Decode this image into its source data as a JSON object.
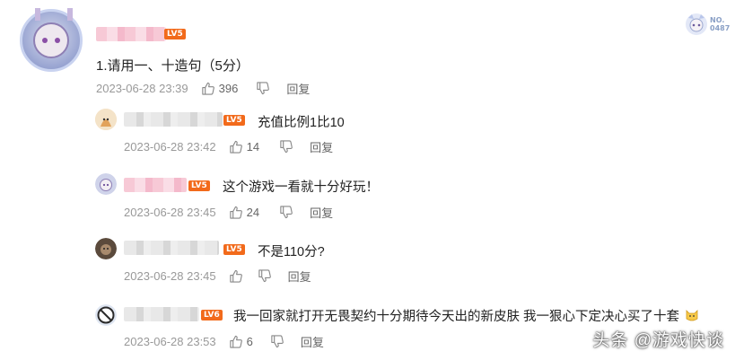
{
  "main_comment": {
    "level_badge": "LV5",
    "text": "1.请用一、十造句（5分）",
    "time": "2023-06-28 23:39",
    "likes": "396",
    "reply_label": "回复"
  },
  "top_right_badge": {
    "label_line1": "NO.",
    "label_line2": "0487"
  },
  "replies": [
    {
      "level_badge": "LV5",
      "text": "充值比例1比10",
      "time": "2023-06-28 23:42",
      "likes": "14",
      "reply_label": "回复"
    },
    {
      "level_badge": "LV5",
      "text": "这个游戏一看就十分好玩！",
      "time": "2023-06-28 23:45",
      "likes": "24",
      "reply_label": "回复"
    },
    {
      "level_badge": "LV5",
      "text": "不是110分?",
      "time": "2023-06-28 23:45",
      "likes": "",
      "reply_label": "回复"
    },
    {
      "level_badge": "LV6",
      "text": "我一回家就打开无畏契约十分期待今天出的新皮肤 我一狠心下定决心买了十套",
      "time": "2023-06-28 23:53",
      "likes": "6",
      "reply_label": "回复"
    }
  ],
  "watermark": "头条 @游戏快谈",
  "colors": {
    "level_badge": "#f26a1b",
    "meta_text": "#999999",
    "body_text": "#222222"
  }
}
